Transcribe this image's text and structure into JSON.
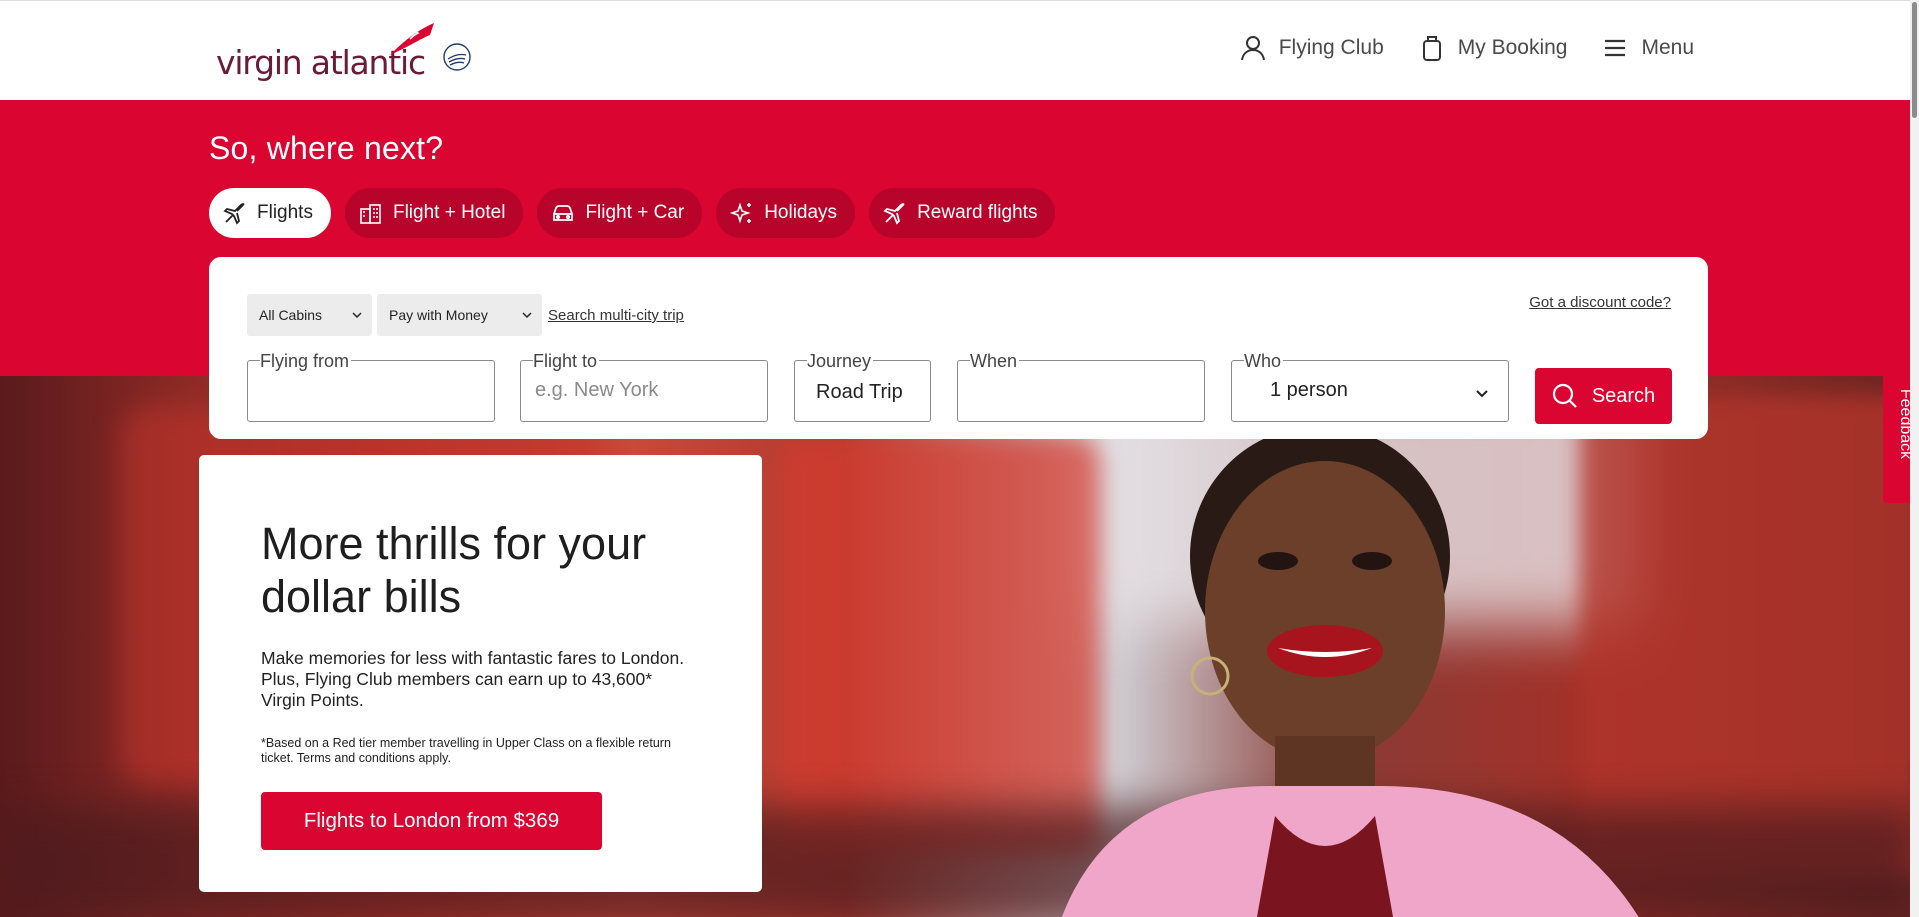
{
  "header": {
    "logo_text": "virgin atlantic",
    "nav": [
      {
        "label": "Flying Club",
        "icon": "person-icon"
      },
      {
        "label": "My Booking",
        "icon": "bag-icon"
      },
      {
        "label": "Menu",
        "icon": "hamburger-icon"
      }
    ]
  },
  "hero": {
    "headline": "So, where next?",
    "tabs": [
      {
        "label": "Flights",
        "icon": "plane-icon",
        "active": true
      },
      {
        "label": "Flight + Hotel",
        "icon": "hotel-icon",
        "active": false
      },
      {
        "label": "Flight + Car",
        "icon": "car-icon",
        "active": false
      },
      {
        "label": "Holidays",
        "icon": "sparkle-icon",
        "active": false
      },
      {
        "label": "Reward flights",
        "icon": "plane-icon",
        "active": false
      }
    ]
  },
  "search": {
    "cabin_select": "All Cabins",
    "payment_select": "Pay with Money",
    "multi_city_link": "Search multi-city trip",
    "discount_link": "Got a discount code?",
    "fields": {
      "from_label": "Flying from",
      "from_value": "",
      "to_label": "Flight to",
      "to_placeholder": "e.g. New York",
      "journey_label": "Journey",
      "journey_value": "Road Trip",
      "when_label": "When",
      "when_value": "",
      "who_label": "Who",
      "who_value": "1 person"
    },
    "search_button": "Search"
  },
  "promo": {
    "title": "More thrills for your dollar bills",
    "body": "Make memories for less with fantastic fares to London. Plus, Flying Club members can earn up to 43,600* Virgin Points.",
    "fine_print": "*Based on a Red tier member travelling in Upper Class on a flexible return ticket. Terms and conditions apply.",
    "cta": "Flights to London from $369"
  },
  "feedback_tab": "Feedback",
  "colors": {
    "brand_red": "#da0530",
    "logo_purple": "#6a1b3a"
  }
}
